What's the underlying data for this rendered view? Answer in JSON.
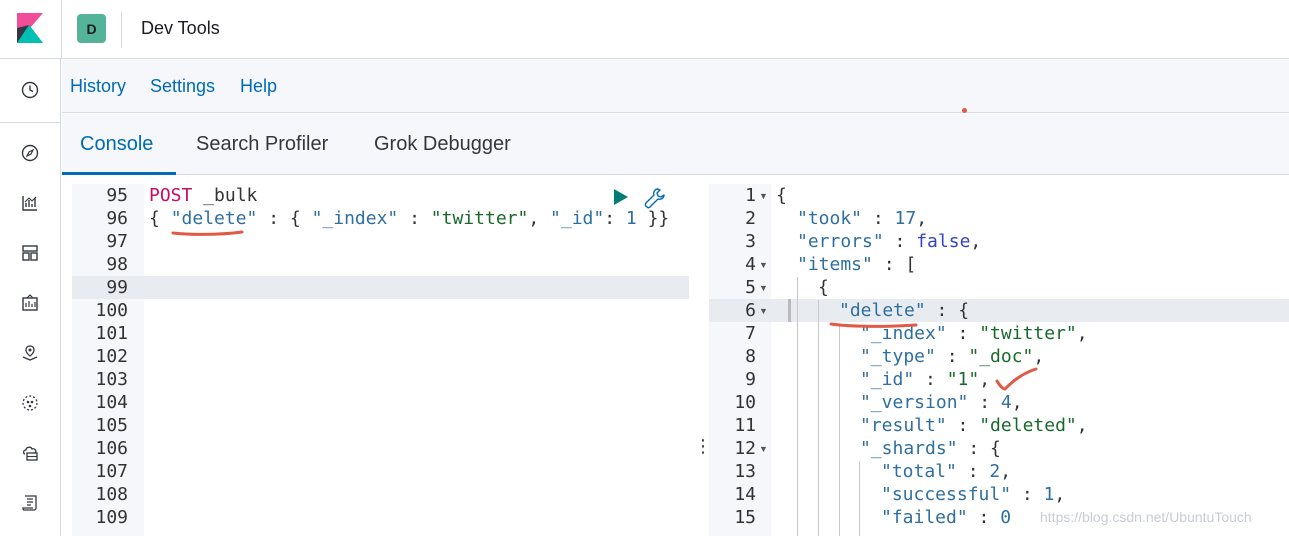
{
  "header": {
    "space_initial": "D",
    "app_title": "Dev Tools"
  },
  "leftnav": {
    "icons": [
      "clock-icon",
      "compass-icon",
      "visualize-icon",
      "dashboard-icon",
      "canvas-icon",
      "maps-icon",
      "ml-icon",
      "infrastructure-icon",
      "logs-icon"
    ]
  },
  "toplinks": {
    "history": "History",
    "settings": "Settings",
    "help": "Help"
  },
  "tabs": {
    "console": "Console",
    "search_profiler": "Search Profiler",
    "grok_debugger": "Grok Debugger",
    "active": "Console"
  },
  "request_editor": {
    "line_numbers": [
      "95",
      "96",
      "97",
      "98",
      "99",
      "100",
      "101",
      "102",
      "103",
      "104",
      "105",
      "106",
      "107",
      "108",
      "109"
    ],
    "method": "POST",
    "endpoint": "_bulk",
    "line96": {
      "open": "{ ",
      "key": "\"delete\"",
      "mid": " : { ",
      "index_key": "\"_index\"",
      "colon1": " : ",
      "index_val": "\"twitter\"",
      "comma": ", ",
      "id_key": "\"_id\"",
      "colon2": ": ",
      "id_val": "1",
      "close": " }}"
    }
  },
  "response_editor": {
    "line_numbers": [
      "1",
      "2",
      "3",
      "4",
      "5",
      "6",
      "7",
      "8",
      "9",
      "10",
      "11",
      "12",
      "13",
      "14",
      "15"
    ],
    "lines": {
      "l1": "{",
      "l2_key": "\"took\"",
      "l2_val": "17",
      "l3_key": "\"errors\"",
      "l3_val": "false",
      "l4_key": "\"items\"",
      "l4_rest": " : [",
      "l5": "{",
      "l6_key": "\"delete\"",
      "l6_rest": " : {",
      "l7_key": "\"_index\"",
      "l7_val": "\"twitter\"",
      "l8_key": "\"_type\"",
      "l8_val": "\"_doc\"",
      "l9_key": "\"_id\"",
      "l9_val": "\"1\"",
      "l10_key": "\"_version\"",
      "l10_val": "4",
      "l11_key": "\"result\"",
      "l11_val": "\"deleted\"",
      "l12_key": "\"_shards\"",
      "l12_rest": " : {",
      "l13_key": "\"total\"",
      "l13_val": "2",
      "l14_key": "\"successful\"",
      "l14_val": "1",
      "l15_key": "\"failed\"",
      "l15_val": "0"
    }
  },
  "splitter_glyph": "⋮",
  "watermark": "https://blog.csdn.net/UbuntuTouch",
  "colors": {
    "accent": "#006bb4",
    "space_badge": "#54b399",
    "annotation": "#e05a45"
  }
}
